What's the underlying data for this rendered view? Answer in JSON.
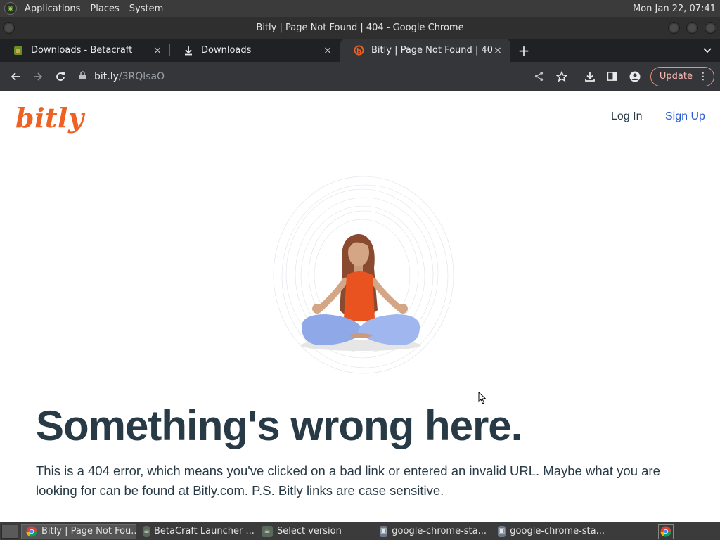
{
  "system_panel": {
    "menus": [
      "Applications",
      "Places",
      "System"
    ],
    "clock": "Mon Jan 22, 07:41"
  },
  "window": {
    "title": "Bitly | Page Not Found | 404 - Google Chrome"
  },
  "tabs": [
    {
      "title": "Downloads - Betacraft",
      "icon": "betacraft-icon",
      "close": "×"
    },
    {
      "title": "Downloads",
      "icon": "download-icon",
      "close": "×"
    },
    {
      "title": "Bitly | Page Not Found | 404",
      "icon": "bitly-favicon",
      "close": "×",
      "active": true
    }
  ],
  "tab_controls": {
    "new_tab": "+",
    "tab_search": "⌄"
  },
  "toolbar": {
    "url_host": "bit.ly",
    "url_path": "/3RQlsaO",
    "update_label": "Update"
  },
  "page": {
    "brand": "bitly",
    "nav": {
      "login": "Log In",
      "signup": "Sign Up"
    },
    "headline": "Something's wrong here.",
    "body_before_link": "This is a 404 error, which means you've clicked on a bad link or entered an invalid URL. Maybe what you are looking for can be found at ",
    "link_text": "Bitly.com",
    "body_after_link": ". P.S. Bitly links are case sensitive."
  },
  "taskbar": {
    "items": [
      {
        "label": "Bitly | Page Not Fou...",
        "icon": "chrome-icon",
        "active": true
      },
      {
        "label": "BetaCraft Launcher ...",
        "icon": "java-icon"
      },
      {
        "label": "Select version",
        "icon": "java-icon"
      },
      {
        "label": "google-chrome-sta...",
        "icon": "terminal-icon"
      },
      {
        "label": "google-chrome-sta...",
        "icon": "terminal-icon"
      }
    ]
  },
  "colors": {
    "brand_orange": "#ee6123",
    "link_blue": "#2a5bd7",
    "text_dark": "#273a46",
    "update_border": "#f28b82"
  }
}
